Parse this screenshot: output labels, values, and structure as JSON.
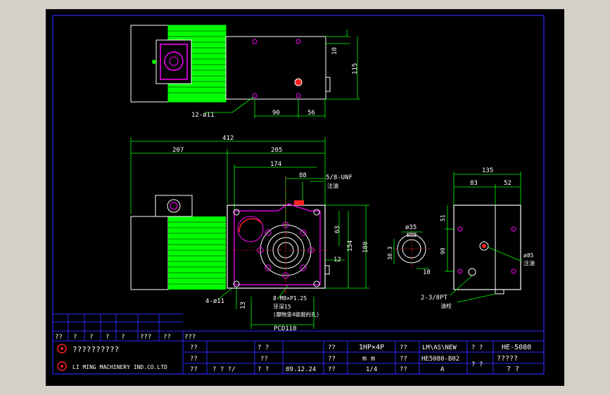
{
  "colors": {
    "outer_bg": "#d4d0c8",
    "canvas": "#000000",
    "frame": "#2a2aff",
    "geometry": "#ffffff",
    "dimension": "#00e000",
    "accent": "#ff2020",
    "magenta": "#ff00ff",
    "label": "#ffffff"
  },
  "top_view": {
    "dim_10": "10",
    "dim_115": "115",
    "dim_90": "90",
    "dim_56": "56",
    "hole_note": "12-ø11"
  },
  "front_view": {
    "dim_412": "412",
    "dim_207": "207",
    "dim_205": "205",
    "dim_174": "174",
    "dim_88": "88",
    "dim_63": "63",
    "dim_154": "154",
    "dim_180": "180",
    "dim_12": "12",
    "dim_13": "13",
    "note_unf": "5/8-UNF",
    "note_unf_sub": "注油",
    "note_holes": "4-ø11",
    "note_tap": "8-M8×P1.25",
    "note_tap_sub": "牙深15",
    "note_tap_sub2": "(躑物釜4级貌的孔)",
    "pcd": "PCD110"
  },
  "side_view": {
    "dim_135": "135",
    "dim_83": "83",
    "dim_52": "52",
    "dim_51": "51",
    "dim_90": "90",
    "phi_85": "ø85",
    "phi_85_sub": "注油",
    "note_bpt": "2-3/8PT",
    "note_bpt_sub": "油栓"
  },
  "shaft_view": {
    "phi_35": "ø35",
    "dim_38": "38.3",
    "dim_10": "10"
  },
  "title_block": {
    "row_small": [
      "??",
      "?",
      "?",
      "?",
      "?",
      "???",
      "??",
      "???"
    ],
    "company_cn": "??????????",
    "company_en": "LI MING MACHINERY IND.CO.LTD",
    "cells": {
      "r1c1": "??",
      "r1c3": "? ?",
      "r1c5": "??",
      "r1c6": "1HP×4P",
      "r1c7": "??",
      "r1c8": "LM\\AS\\NEW",
      "r1c9": "? ?",
      "r1c10": "HE-5080",
      "r2c1": "??",
      "r2c3": "??",
      "r2c5": "??",
      "r2c6": "m m",
      "r2c7": "??",
      "r2c8": "HE5080-B02",
      "r2c9": "? ?",
      "r2c10": "?????",
      "r3c1": "??",
      "r3c2": "? ?  ?/",
      "r3c3": "? ?",
      "r3c4": "89.12.24",
      "r3c5": "??",
      "r3c6": "1/4",
      "r3c7": "??",
      "r3c8": "A",
      "r3c10": "? ?"
    }
  }
}
